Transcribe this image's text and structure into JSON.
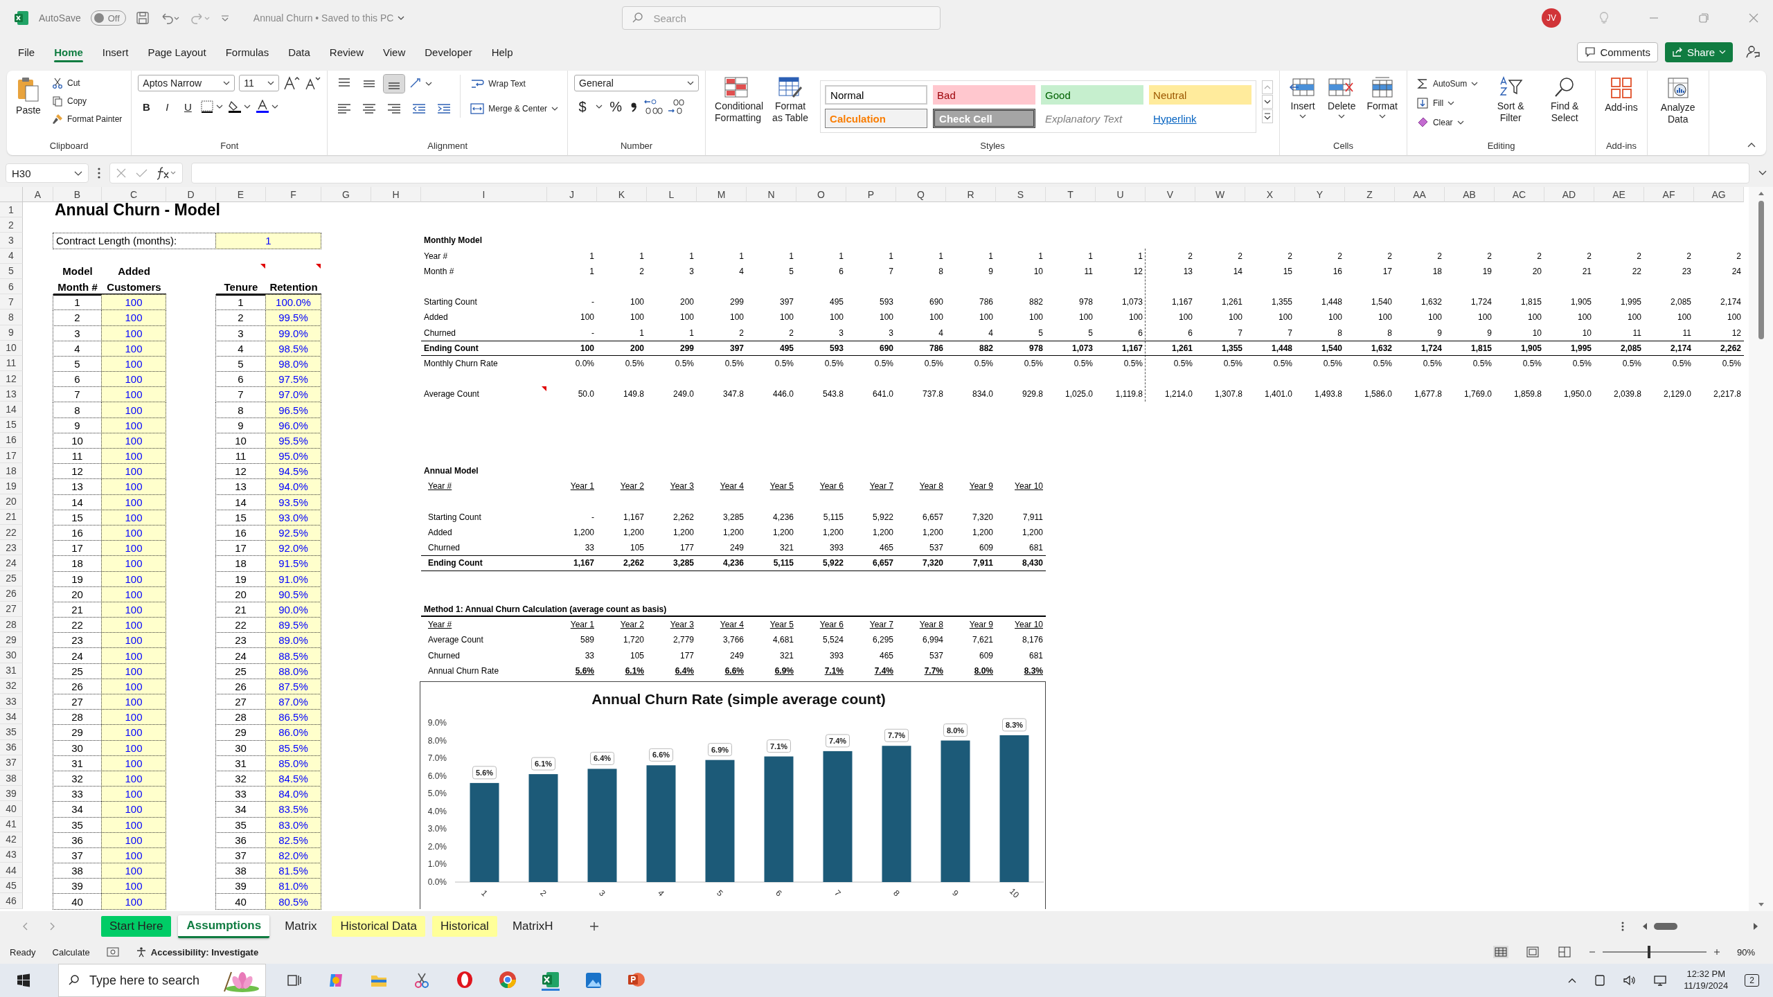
{
  "title_bar": {
    "autosave_label": "AutoSave",
    "autosave_state": "Off",
    "autosave_on": false,
    "document_title": "Annual Churn • Saved to this PC",
    "search_placeholder": "Search",
    "account_initials": "JV"
  },
  "menu_tabs": [
    {
      "label": "File",
      "selected": false
    },
    {
      "label": "Home",
      "selected": true
    },
    {
      "label": "Insert",
      "selected": false
    },
    {
      "label": "Page Layout",
      "selected": false
    },
    {
      "label": "Formulas",
      "selected": false
    },
    {
      "label": "Data",
      "selected": false
    },
    {
      "label": "Review",
      "selected": false
    },
    {
      "label": "View",
      "selected": false
    },
    {
      "label": "Developer",
      "selected": false
    },
    {
      "label": "Help",
      "selected": false
    }
  ],
  "menu_buttons": {
    "comments": "Comments",
    "share": "Share"
  },
  "ribbon": {
    "clipboard": {
      "paste": "Paste",
      "cut": "Cut",
      "copy": "Copy",
      "format_painter": "Format Painter",
      "group_label": "Clipboard"
    },
    "font": {
      "font_name": "Aptos Narrow",
      "font_size": "11",
      "bold": "B",
      "italic": "I",
      "underline": "U",
      "group_label": "Font"
    },
    "alignment": {
      "wrap_text": "Wrap Text",
      "merge_center": "Merge & Center",
      "group_label": "Alignment"
    },
    "number": {
      "format": "General",
      "currency": "$",
      "percent": "%",
      "group_label": "Number"
    },
    "styles": {
      "conditional_formatting": "Conditional Formatting",
      "format_as_table": "Format as Table",
      "group_label": "Styles",
      "cell_styles": [
        {
          "label": "Normal",
          "kind": "normal"
        },
        {
          "label": "Bad",
          "kind": "bad"
        },
        {
          "label": "Good",
          "kind": "good"
        },
        {
          "label": "Neutral",
          "kind": "neutral"
        },
        {
          "label": "Calculation",
          "kind": "calculation"
        },
        {
          "label": "Check Cell",
          "kind": "check"
        },
        {
          "label": "Explanatory Text",
          "kind": "explanatory"
        },
        {
          "label": "Hyperlink",
          "kind": "hyperlink"
        }
      ]
    },
    "cells": {
      "insert": "Insert",
      "delete": "Delete",
      "format": "Format",
      "group_label": "Cells"
    },
    "editing": {
      "autosum": "AutoSum",
      "fill": "Fill",
      "clear": "Clear",
      "sort_filter": "Sort & Filter",
      "find_select": "Find & Select",
      "group_label": "Editing"
    },
    "add_ins": {
      "add_ins": "Add-ins",
      "group_label": "Add-ins"
    },
    "analyze_data": "Analyze Data"
  },
  "formula_bar": {
    "name_box": "H30"
  },
  "column_headers": [
    "A",
    "B",
    "C",
    "D",
    "E",
    "F",
    "G",
    "H",
    "I",
    "J",
    "K",
    "L",
    "M",
    "N",
    "O",
    "P",
    "Q",
    "R",
    "S",
    "T",
    "U",
    "V",
    "W",
    "X",
    "Y",
    "Z",
    "AA",
    "AB",
    "AC",
    "AD",
    "AE",
    "AF",
    "AG"
  ],
  "row_headers": [
    "1",
    "2",
    "3",
    "4",
    "5",
    "6",
    "7",
    "8",
    "9",
    "10",
    "11",
    "12",
    "13",
    "14",
    "15",
    "16",
    "17",
    "18",
    "19",
    "20",
    "21",
    "22",
    "23",
    "24",
    "25",
    "26",
    "27",
    "28",
    "29",
    "30",
    "31",
    "32",
    "33",
    "34",
    "35",
    "36",
    "37",
    "38",
    "39",
    "40",
    "41",
    "42",
    "43",
    "44",
    "45",
    "46"
  ],
  "sheet": {
    "title": "Annual Churn - Model",
    "contract_length": {
      "label": "Contract Length (months):",
      "value": "1"
    },
    "inputs_table": {
      "headers": [
        "Model",
        "Added",
        "Month #",
        "Customers"
      ],
      "rows": [
        {
          "month": "1",
          "added": "100"
        },
        {
          "month": "2",
          "added": "100"
        },
        {
          "month": "3",
          "added": "100"
        },
        {
          "month": "4",
          "added": "100"
        },
        {
          "month": "5",
          "added": "100"
        },
        {
          "month": "6",
          "added": "100"
        },
        {
          "month": "7",
          "added": "100"
        },
        {
          "month": "8",
          "added": "100"
        },
        {
          "month": "9",
          "added": "100"
        },
        {
          "month": "10",
          "added": "100"
        },
        {
          "month": "11",
          "added": "100"
        },
        {
          "month": "12",
          "added": "100"
        },
        {
          "month": "13",
          "added": "100"
        },
        {
          "month": "14",
          "added": "100"
        },
        {
          "month": "15",
          "added": "100"
        },
        {
          "month": "16",
          "added": "100"
        },
        {
          "month": "17",
          "added": "100"
        },
        {
          "month": "18",
          "added": "100"
        },
        {
          "month": "19",
          "added": "100"
        },
        {
          "month": "20",
          "added": "100"
        },
        {
          "month": "21",
          "added": "100"
        },
        {
          "month": "22",
          "added": "100"
        },
        {
          "month": "23",
          "added": "100"
        },
        {
          "month": "24",
          "added": "100"
        },
        {
          "month": "25",
          "added": "100"
        },
        {
          "month": "26",
          "added": "100"
        },
        {
          "month": "27",
          "added": "100"
        },
        {
          "month": "28",
          "added": "100"
        },
        {
          "month": "29",
          "added": "100"
        },
        {
          "month": "30",
          "added": "100"
        },
        {
          "month": "31",
          "added": "100"
        },
        {
          "month": "32",
          "added": "100"
        },
        {
          "month": "33",
          "added": "100"
        },
        {
          "month": "34",
          "added": "100"
        },
        {
          "month": "35",
          "added": "100"
        },
        {
          "month": "36",
          "added": "100"
        },
        {
          "month": "37",
          "added": "100"
        },
        {
          "month": "38",
          "added": "100"
        },
        {
          "month": "39",
          "added": "100"
        },
        {
          "month": "40",
          "added": "100"
        }
      ]
    },
    "retention_table": {
      "headers": [
        {
          "label": "Tenure",
          "comment": true
        },
        {
          "label": "Retention",
          "comment": true
        }
      ],
      "rows": [
        {
          "tenure": "1",
          "retention": "100.0%"
        },
        {
          "tenure": "2",
          "retention": "99.5%"
        },
        {
          "tenure": "3",
          "retention": "99.0%"
        },
        {
          "tenure": "4",
          "retention": "98.5%"
        },
        {
          "tenure": "5",
          "retention": "98.0%"
        },
        {
          "tenure": "6",
          "retention": "97.5%"
        },
        {
          "tenure": "7",
          "retention": "97.0%"
        },
        {
          "tenure": "8",
          "retention": "96.5%"
        },
        {
          "tenure": "9",
          "retention": "96.0%"
        },
        {
          "tenure": "10",
          "retention": "95.5%"
        },
        {
          "tenure": "11",
          "retention": "95.0%"
        },
        {
          "tenure": "12",
          "retention": "94.5%"
        },
        {
          "tenure": "13",
          "retention": "94.0%"
        },
        {
          "tenure": "14",
          "retention": "93.5%"
        },
        {
          "tenure": "15",
          "retention": "93.0%"
        },
        {
          "tenure": "16",
          "retention": "92.5%"
        },
        {
          "tenure": "17",
          "retention": "92.0%"
        },
        {
          "tenure": "18",
          "retention": "91.5%"
        },
        {
          "tenure": "19",
          "retention": "91.0%"
        },
        {
          "tenure": "20",
          "retention": "90.5%"
        },
        {
          "tenure": "21",
          "retention": "90.0%"
        },
        {
          "tenure": "22",
          "retention": "89.5%"
        },
        {
          "tenure": "23",
          "retention": "89.0%"
        },
        {
          "tenure": "24",
          "retention": "88.5%"
        },
        {
          "tenure": "25",
          "retention": "88.0%"
        },
        {
          "tenure": "26",
          "retention": "87.5%"
        },
        {
          "tenure": "27",
          "retention": "87.0%"
        },
        {
          "tenure": "28",
          "retention": "86.5%"
        },
        {
          "tenure": "29",
          "retention": "86.0%"
        },
        {
          "tenure": "30",
          "retention": "85.5%"
        },
        {
          "tenure": "31",
          "retention": "85.0%"
        },
        {
          "tenure": "32",
          "retention": "84.5%"
        },
        {
          "tenure": "33",
          "retention": "84.0%"
        },
        {
          "tenure": "34",
          "retention": "83.5%"
        },
        {
          "tenure": "35",
          "retention": "83.0%"
        },
        {
          "tenure": "36",
          "retention": "82.5%"
        },
        {
          "tenure": "37",
          "retention": "82.0%"
        },
        {
          "tenure": "38",
          "retention": "81.5%"
        },
        {
          "tenure": "39",
          "retention": "81.0%"
        },
        {
          "tenure": "40",
          "retention": "80.5%"
        }
      ]
    },
    "monthly_model": {
      "title": "Monthly Model",
      "header_rows": [
        {
          "label": "Year #",
          "values": [
            "1",
            "1",
            "1",
            "1",
            "1",
            "1",
            "1",
            "1",
            "1",
            "1",
            "1",
            "1",
            "2",
            "2",
            "2",
            "2",
            "2",
            "2",
            "2",
            "2",
            "2",
            "2",
            "2",
            "2"
          ]
        },
        {
          "label": "Month #",
          "values": [
            "1",
            "2",
            "3",
            "4",
            "5",
            "6",
            "7",
            "8",
            "9",
            "10",
            "11",
            "12",
            "13",
            "14",
            "15",
            "16",
            "17",
            "18",
            "19",
            "20",
            "21",
            "22",
            "23",
            "24"
          ]
        }
      ],
      "rows": [
        {
          "label": "Starting Count",
          "kind": "normal",
          "values": [
            "-",
            "100",
            "200",
            "299",
            "397",
            "495",
            "593",
            "690",
            "786",
            "882",
            "978",
            "1,073",
            "1,167",
            "1,261",
            "1,355",
            "1,448",
            "1,540",
            "1,632",
            "1,724",
            "1,815",
            "1,905",
            "1,995",
            "2,085",
            "2,174"
          ]
        },
        {
          "label": "Added",
          "kind": "normal",
          "values": [
            "100",
            "100",
            "100",
            "100",
            "100",
            "100",
            "100",
            "100",
            "100",
            "100",
            "100",
            "100",
            "100",
            "100",
            "100",
            "100",
            "100",
            "100",
            "100",
            "100",
            "100",
            "100",
            "100",
            "100"
          ]
        },
        {
          "label": "Churned",
          "kind": "normal",
          "values": [
            "-",
            "1",
            "1",
            "2",
            "2",
            "3",
            "3",
            "4",
            "4",
            "5",
            "5",
            "6",
            "6",
            "7",
            "7",
            "8",
            "8",
            "9",
            "9",
            "10",
            "10",
            "11",
            "11",
            "12"
          ]
        },
        {
          "label": "Ending Count",
          "kind": "total",
          "values": [
            "100",
            "200",
            "299",
            "397",
            "495",
            "593",
            "690",
            "786",
            "882",
            "978",
            "1,073",
            "1,167",
            "1,261",
            "1,355",
            "1,448",
            "1,540",
            "1,632",
            "1,724",
            "1,815",
            "1,905",
            "1,995",
            "2,085",
            "2,174",
            "2,262"
          ]
        },
        {
          "label": "Monthly Churn Rate",
          "kind": "normal",
          "values": [
            "0.0%",
            "0.5%",
            "0.5%",
            "0.5%",
            "0.5%",
            "0.5%",
            "0.5%",
            "0.5%",
            "0.5%",
            "0.5%",
            "0.5%",
            "0.5%",
            "0.5%",
            "0.5%",
            "0.5%",
            "0.5%",
            "0.5%",
            "0.5%",
            "0.5%",
            "0.5%",
            "0.5%",
            "0.5%",
            "0.5%",
            "0.5%"
          ]
        }
      ],
      "average_row": {
        "label": "Average Count",
        "comment": true,
        "values": [
          "50.0",
          "149.8",
          "249.0",
          "347.8",
          "446.0",
          "543.8",
          "641.0",
          "737.8",
          "834.0",
          "929.8",
          "1,025.0",
          "1,119.8",
          "1,214.0",
          "1,307.8",
          "1,401.0",
          "1,493.8",
          "1,586.0",
          "1,677.8",
          "1,769.0",
          "1,859.8",
          "1,950.0",
          "2,039.8",
          "2,129.0",
          "2,217.8"
        ]
      }
    },
    "annual_model": {
      "title": "Annual Model",
      "header": {
        "label": "Year #",
        "values": [
          "Year 1",
          "Year 2",
          "Year 3",
          "Year 4",
          "Year 5",
          "Year 6",
          "Year 7",
          "Year 8",
          "Year 9",
          "Year 10"
        ]
      },
      "rows": [
        {
          "label": "Starting Count",
          "kind": "normal",
          "values": [
            "-",
            "1,167",
            "2,262",
            "3,285",
            "4,236",
            "5,115",
            "5,922",
            "6,657",
            "7,320",
            "7,911"
          ]
        },
        {
          "label": "Added",
          "kind": "normal",
          "values": [
            "1,200",
            "1,200",
            "1,200",
            "1,200",
            "1,200",
            "1,200",
            "1,200",
            "1,200",
            "1,200",
            "1,200"
          ]
        },
        {
          "label": "Churned",
          "kind": "normal",
          "values": [
            "33",
            "105",
            "177",
            "249",
            "321",
            "393",
            "465",
            "537",
            "609",
            "681"
          ]
        },
        {
          "label": "Ending Count",
          "kind": "total",
          "values": [
            "1,167",
            "2,262",
            "3,285",
            "4,236",
            "5,115",
            "5,922",
            "6,657",
            "7,320",
            "7,911",
            "8,430"
          ]
        }
      ]
    },
    "method_1": {
      "title": "Method 1: Annual Churn Calculation (average count as basis)",
      "header": {
        "label": "Year #",
        "values": [
          "Year 1",
          "Year 2",
          "Year 3",
          "Year 4",
          "Year 5",
          "Year 6",
          "Year 7",
          "Year 8",
          "Year 9",
          "Year 10"
        ]
      },
      "rows": [
        {
          "label": "Average Count",
          "kind": "normal",
          "values": [
            "589",
            "1,720",
            "2,779",
            "3,766",
            "4,681",
            "5,524",
            "6,295",
            "6,994",
            "7,621",
            "8,176"
          ]
        },
        {
          "label": "Churned",
          "kind": "normal",
          "values": [
            "33",
            "105",
            "177",
            "249",
            "321",
            "393",
            "465",
            "537",
            "609",
            "681"
          ]
        },
        {
          "label": "Annual Churn Rate",
          "kind": "rate",
          "values": [
            "5.6%",
            "6.1%",
            "6.4%",
            "6.6%",
            "6.9%",
            "7.1%",
            "7.4%",
            "7.7%",
            "8.0%",
            "8.3%"
          ]
        }
      ],
      "chart_data": {
        "type": "bar",
        "title": "Annual Churn Rate (simple average count)",
        "categories": [
          "1",
          "2",
          "3",
          "4",
          "5",
          "6",
          "7",
          "8",
          "9",
          "10"
        ],
        "values": [
          5.6,
          6.1,
          6.4,
          6.6,
          6.9,
          7.1,
          7.4,
          7.7,
          8.0,
          8.3
        ],
        "ylim": [
          0,
          9
        ],
        "yticks": [
          {
            "value": 0,
            "label": "0.0%"
          },
          {
            "value": 1,
            "label": "1.0%"
          },
          {
            "value": 2,
            "label": "2.0%"
          },
          {
            "value": 3,
            "label": "3.0%"
          },
          {
            "value": 4,
            "label": "4.0%"
          },
          {
            "value": 5,
            "label": "5.0%"
          },
          {
            "value": 6,
            "label": "6.0%"
          },
          {
            "value": 7,
            "label": "7.0%"
          },
          {
            "value": 8,
            "label": "8.0%"
          },
          {
            "value": 9,
            "label": "9.0%"
          }
        ],
        "value_labels": [
          "5.6%",
          "6.1%",
          "6.4%",
          "6.6%",
          "6.9%",
          "7.1%",
          "7.4%",
          "7.7%",
          "8.0%",
          "8.3%"
        ]
      }
    }
  },
  "sheet_tabs": [
    {
      "label": "Start Here",
      "selected": false,
      "color": "#00cc66"
    },
    {
      "label": "Assumptions",
      "selected": true
    },
    {
      "label": "Matrix",
      "selected": false
    },
    {
      "label": "Historical Data",
      "selected": false,
      "color": "#ffff99"
    },
    {
      "label": "Historical",
      "selected": false,
      "color": "#ffff99"
    },
    {
      "label": "MatrixH",
      "selected": false
    }
  ],
  "status_bar": {
    "mode": "Ready",
    "calculate": "Calculate",
    "accessibility": "Accessibility: Investigate",
    "zoom": "90%",
    "level": 0.45
  },
  "taskbar": {
    "search_placeholder": "Type here to search",
    "time": "12:32 PM",
    "date": "11/19/2024",
    "notifications": "2"
  }
}
